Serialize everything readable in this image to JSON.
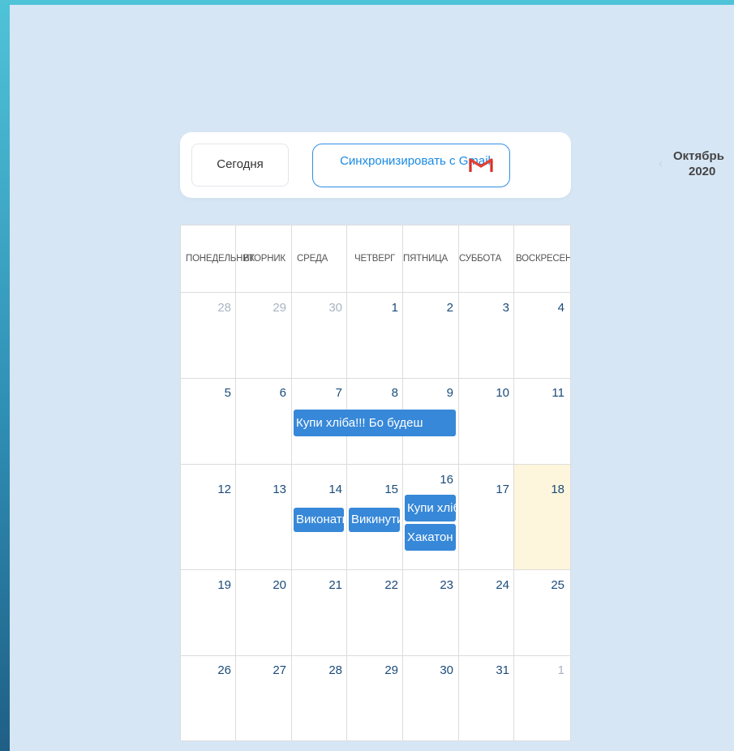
{
  "toolbar": {
    "today_label": "Сегодня",
    "sync_label": "Синхронизировать с Gmail",
    "month": "Октябрь",
    "year": "2020",
    "prev_icon": "chevron-left-icon",
    "gmail_icon": "gmail-icon"
  },
  "calendar": {
    "weekdays": [
      "ПОНЕДЕЛЬНИК",
      "ВТОРНИК",
      "СРЕДА",
      "ЧЕТВЕРГ",
      "ПЯТНИЦА",
      "СУББОТА",
      "ВОСКРЕСЕНЬЕ"
    ],
    "weeks": [
      [
        "28",
        "29",
        "30",
        "1",
        "2",
        "3",
        "4"
      ],
      [
        "5",
        "6",
        "7",
        "8",
        "9",
        "10",
        "11"
      ],
      [
        "12",
        "13",
        "14",
        "15",
        "16",
        "17",
        "18"
      ],
      [
        "19",
        "20",
        "21",
        "22",
        "23",
        "24",
        "25"
      ],
      [
        "26",
        "27",
        "28",
        "29",
        "30",
        "31",
        "1"
      ]
    ],
    "today": "18",
    "events": [
      {
        "title": "Купи хліба!!! Бо будеш"
      },
      {
        "title": "Виконати"
      },
      {
        "title": "Викинути"
      },
      {
        "title": "Купи хліба"
      },
      {
        "title": "Хакатон"
      }
    ]
  },
  "colors": {
    "event": "#3788d8",
    "today": "#fdf6dc",
    "accent": "#1a8ae5"
  }
}
